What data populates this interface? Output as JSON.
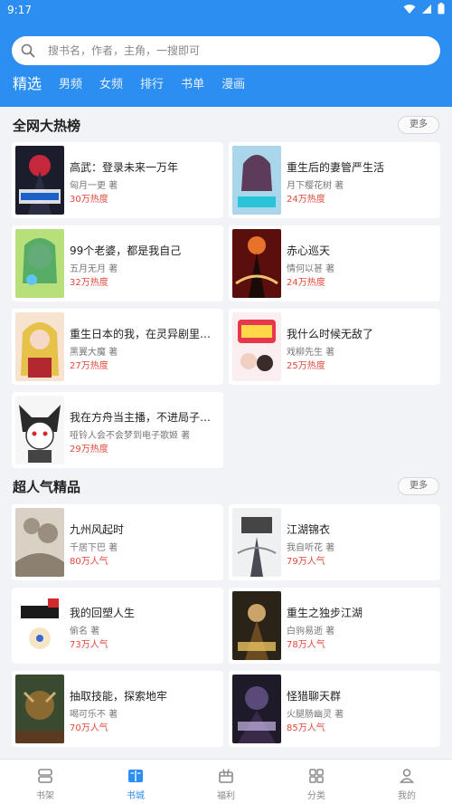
{
  "status_bar": {
    "time": "9:17"
  },
  "search": {
    "placeholder": "搜书名，作者，主角，一搜即可"
  },
  "tabs": [
    {
      "label": "精选",
      "active": true
    },
    {
      "label": "男频"
    },
    {
      "label": "女频"
    },
    {
      "label": "排行"
    },
    {
      "label": "书单"
    },
    {
      "label": "漫画"
    }
  ],
  "sections": [
    {
      "title": "全网大热榜",
      "more": "更多",
      "books": [
        {
          "title": "高武：登录未来一万年",
          "author": "匈月一更 著",
          "stat": "30万热度"
        },
        {
          "title": "重生后的妻管严生活",
          "author": "月下樱花树 著",
          "stat": "24万热度"
        },
        {
          "title": "99个老婆，都是我自己",
          "author": "五月无月 著",
          "stat": "32万热度"
        },
        {
          "title": "赤心巡天",
          "author": "情何以甚 著",
          "stat": "24万热度"
        },
        {
          "title": "重生日本的我，在灵异剧里开...",
          "author": "黑翼大魔 著",
          "stat": "27万热度"
        },
        {
          "title": "我什么时候无敌了",
          "author": "戏柳先生 著",
          "stat": "25万热度"
        },
        {
          "title": "我在方舟当主播，不进局子就...",
          "author": "哑铃人会不会梦到电子歌姬 著",
          "stat": "29万热度"
        }
      ]
    },
    {
      "title": "超人气精品",
      "more": "更多",
      "books": [
        {
          "title": "九州风起时",
          "author": "千居下巴 著",
          "stat": "80万人气"
        },
        {
          "title": "江湖锦衣",
          "author": "我自听花 著",
          "stat": "79万人气"
        },
        {
          "title": "我的回塑人生",
          "author": "偷名 著",
          "stat": "73万人气"
        },
        {
          "title": "重生之独步江湖",
          "author": "白驹易逝 著",
          "stat": "78万人气"
        },
        {
          "title": "抽取技能，探索地牢",
          "author": "喝可乐不 著",
          "stat": "70万人气"
        },
        {
          "title": "怪猎聊天群",
          "author": "火腿肠幽灵 著",
          "stat": "85万人气"
        }
      ]
    }
  ],
  "bottom_nav": [
    {
      "label": "书架",
      "icon": "bookshelf-icon"
    },
    {
      "label": "书城",
      "icon": "book-store-icon",
      "active": true
    },
    {
      "label": "福利",
      "icon": "gift-icon"
    },
    {
      "label": "分类",
      "icon": "category-grid-icon"
    },
    {
      "label": "我的",
      "icon": "profile-icon"
    }
  ],
  "colors": {
    "accent": "#2c8ef0",
    "heat": "#e5483a"
  }
}
